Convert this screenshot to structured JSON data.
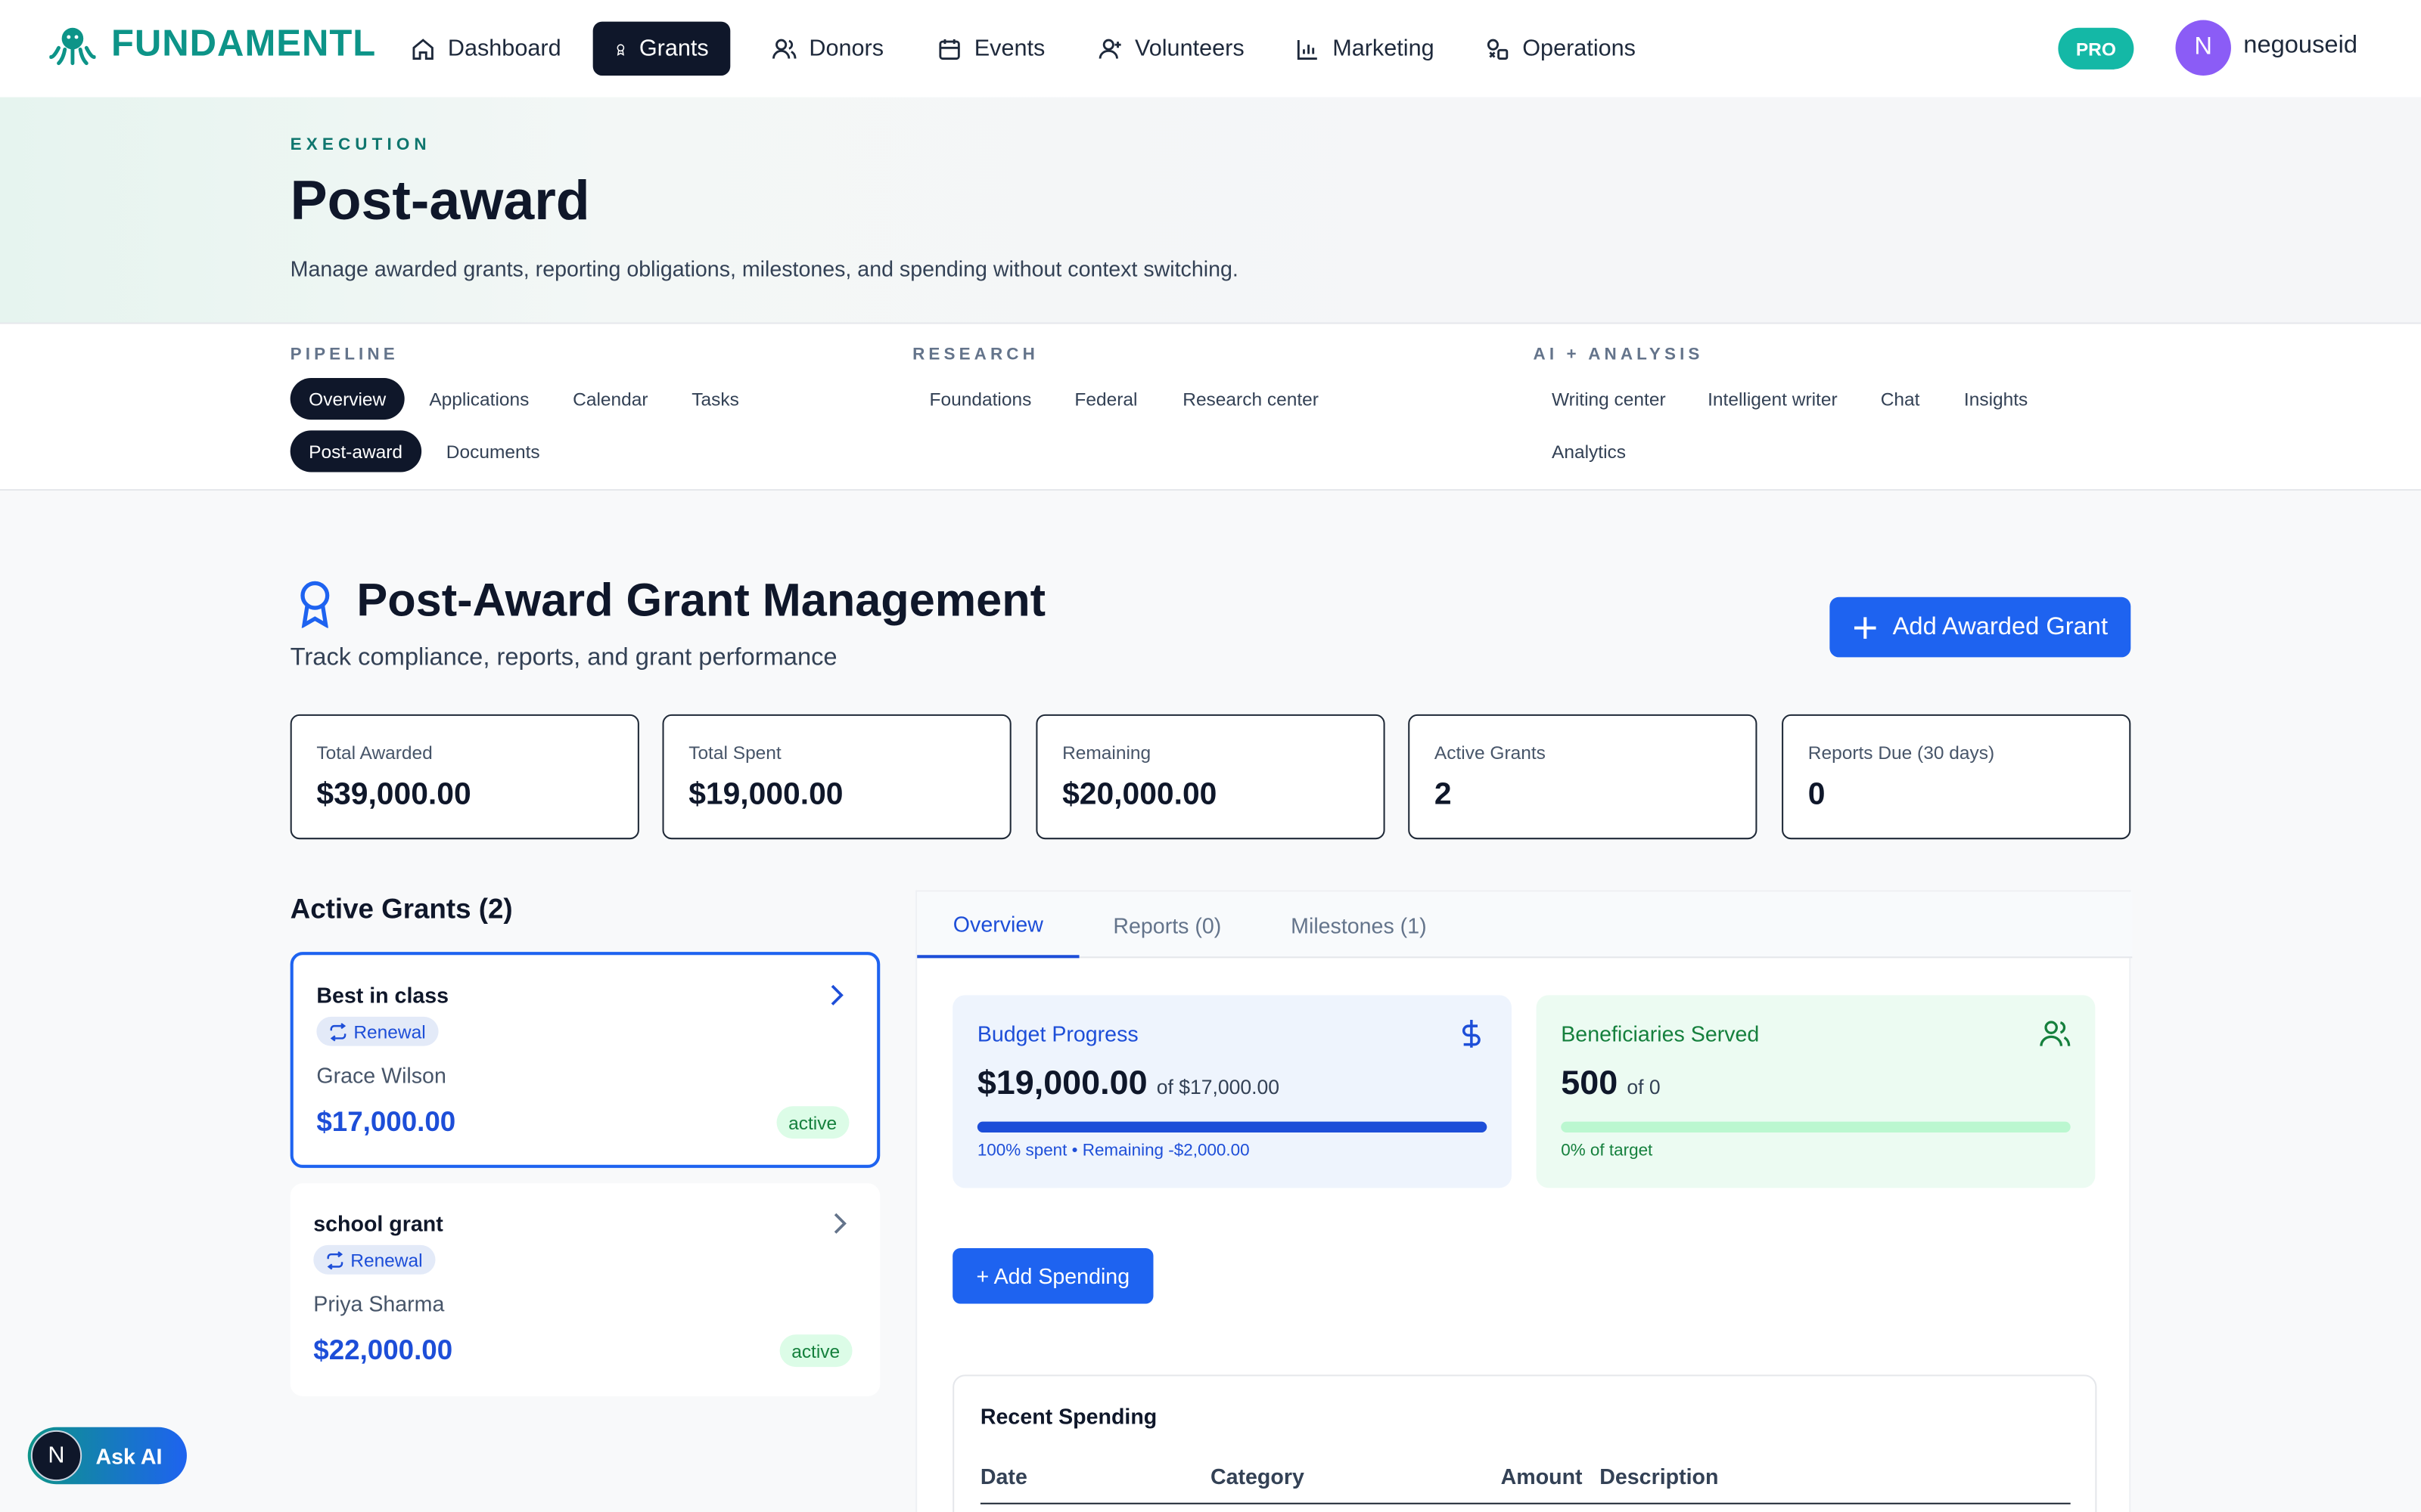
{
  "app": {
    "name": "FUNDAMENTL"
  },
  "nav": {
    "items": [
      {
        "label": "Dashboard",
        "icon": "home-icon"
      },
      {
        "label": "Grants",
        "icon": "award-icon",
        "active": true
      },
      {
        "label": "Donors",
        "icon": "users-icon"
      },
      {
        "label": "Events",
        "icon": "calendar-icon"
      },
      {
        "label": "Volunteers",
        "icon": "user-plus-icon"
      },
      {
        "label": "Marketing",
        "icon": "bar-chart-icon"
      },
      {
        "label": "Operations",
        "icon": "shapes-icon"
      }
    ],
    "badge": "PRO",
    "avatar_initial": "N",
    "username": "negouseid"
  },
  "hero": {
    "eyebrow": "EXECUTION",
    "title": "Post-award",
    "description": "Manage awarded grants, reporting obligations, milestones, and spending without context switching."
  },
  "subnav": {
    "pipeline": {
      "label": "PIPELINE",
      "items": [
        "Overview",
        "Applications",
        "Calendar",
        "Tasks",
        "Post-award",
        "Documents"
      ]
    },
    "research": {
      "label": "RESEARCH",
      "items": [
        "Foundations",
        "Federal",
        "Research center"
      ]
    },
    "ai": {
      "label": "AI + ANALYSIS",
      "items": [
        "Writing center",
        "Intelligent writer",
        "Chat",
        "Insights",
        "Analytics"
      ]
    }
  },
  "page": {
    "title": "Post-Award Grant Management",
    "subtitle": "Track compliance, reports, and grant performance",
    "add_button": "Add Awarded Grant"
  },
  "stats": [
    {
      "label": "Total Awarded",
      "value": "$39,000.00"
    },
    {
      "label": "Total Spent",
      "value": "$19,000.00"
    },
    {
      "label": "Remaining",
      "value": "$20,000.00"
    },
    {
      "label": "Active Grants",
      "value": "2"
    },
    {
      "label": "Reports Due (30 days)",
      "value": "0"
    }
  ],
  "active_grants": {
    "title": "Active Grants (2)",
    "items": [
      {
        "name": "Best in class",
        "tag": "Renewal",
        "person": "Grace Wilson",
        "amount": "$17,000.00",
        "status": "active"
      },
      {
        "name": "school grant",
        "tag": "Renewal",
        "person": "Priya Sharma",
        "amount": "$22,000.00",
        "status": "active"
      }
    ]
  },
  "detail": {
    "tabs": [
      "Overview",
      "Reports (0)",
      "Milestones (1)"
    ],
    "budget": {
      "label": "Budget Progress",
      "value": "$19,000.00",
      "of": "of $17,000.00",
      "progress": 1.0,
      "note": "100% spent • Remaining -$2,000.00",
      "color": "#1d4ed8"
    },
    "beneficiaries": {
      "label": "Beneficiaries Served",
      "value": "500",
      "of": "of 0",
      "progress": 0,
      "note": "0% of target",
      "color": "#15803d"
    },
    "add_spending": "+ Add Spending",
    "recent": {
      "title": "Recent Spending",
      "columns": [
        "Date",
        "Category",
        "Amount",
        "Description"
      ]
    }
  },
  "ask_ai": {
    "initial": "N",
    "label": "Ask AI"
  }
}
